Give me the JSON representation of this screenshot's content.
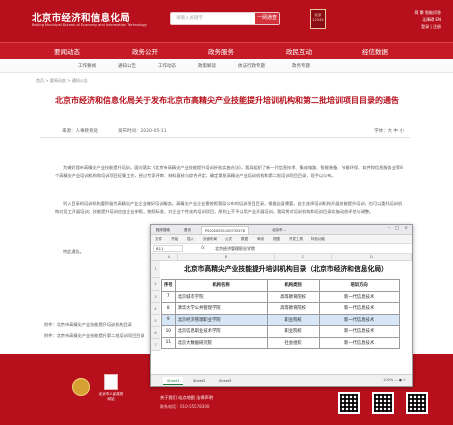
{
  "header": {
    "site_title": "北京市经济和信息化局",
    "site_subtitle": "Beijing Municipal Bureau of Economy and Information Technology",
    "search_placeholder": "请输入关键字",
    "search_button": "一网通查",
    "seal_text": "北京 12345",
    "right_line1": "简  繁  智能问答",
    "right_line2": "无障碍  EN",
    "right_line3": "登录 | 注册"
  },
  "nav": [
    "要闻动态",
    "政务公开",
    "政务服务",
    "政民互动",
    "经信数据"
  ],
  "subnav": [
    "工作要闻",
    "通知公告",
    "工作动态",
    "政策解读",
    "依法行政专题",
    "政务专题"
  ],
  "breadcrumb": "首页 > 要闻动态 > 通知公告",
  "article": {
    "title": "北京市经济和信息化局关于发布北京市高精尖产业技能提升培训机构和第二批培训项目目录的通告",
    "source": "来源：人事教育处",
    "date": "发布时间：2020-05-11",
    "font_size": "字体：大 中 小",
    "paragraphs": [
      "为做好我市高精尖产业技能提升培训，面向落实《北京市高精尖产业技能提升培训补贴实施办法》，我局组织了新一代信息技术、集成电路、智能装备、节能环保、软件和信息服务业等8个高精尖产业培训机构和培训项目征集工作，经过专家评审、材料复核与综合评定，确定第批高精尖产业培训机构和第二批培训项目目录，现予以公布。",
      "列入目录的培训机构要积极为高精尖产业企业做好培训服务。高精尖产业企业需按照我局公布的培训项目目录，根据自身需要，自主选择培训机构开展技能提升培训，也可以委托培训机构对员工开展培训；技能提升培训应由企业申报，按照标准，对企业个性化的培训项目，原则上不予以用产业开展培训。我局将对培训机构和培训目录实施动态评估与调整。",
      "特此通告。"
    ],
    "attachment1": "附件：北京市高精尖产业技能提升培训机构目录",
    "attachment2": "附件：北京市高精尖产业技能提升第二批培训项目目录"
  },
  "footer": {
    "badge_text": "北京市人民政府 网站",
    "links": "关于我们    站点地图    法律声明",
    "contact": "联系电话：010-55578300"
  },
  "spreadsheet": {
    "window_tabs": [
      "程序搜索",
      "首页",
      "PS2020051100732578",
      "北京市..."
    ],
    "menu": [
      "文件",
      "开始",
      "插入",
      "页面布局",
      "公式",
      "数据",
      "审阅",
      "视图",
      "开发工具",
      "特色功能"
    ],
    "cell_ref": "B11",
    "fx_symbol": "fx",
    "formula_value": "北京经济管理职业学院",
    "columns": [
      "A",
      "B",
      "C",
      "D"
    ],
    "row_numbers": [
      "1",
      "2",
      "3",
      "4",
      "5",
      "6",
      "7"
    ],
    "title": "北京市高精尖产业技能提升培训机构目录（北京市经济和信息化局）",
    "headers": [
      "序号",
      "机构名称",
      "机构类别",
      "培训方向"
    ],
    "rows": [
      [
        "7",
        "北京城市学院",
        "高等教育院校",
        "新一代信息技术"
      ],
      [
        "8",
        "清华大学公共管理学院",
        "高等教育院校",
        "新一代信息技术"
      ],
      [
        "9",
        "北京经济管理职业学院",
        "职业院校",
        "新一代信息技术"
      ],
      [
        "10",
        "北京信息职业技术学院",
        "职业院校",
        "新一代信息技术"
      ],
      [
        "11",
        "北京大数据研究院",
        "社会组织",
        "新一代信息技术"
      ]
    ],
    "sheet_tabs": [
      "Sheet1",
      "Sheet2",
      "Sheet3"
    ],
    "zoom": "100%  —  ●  +"
  }
}
